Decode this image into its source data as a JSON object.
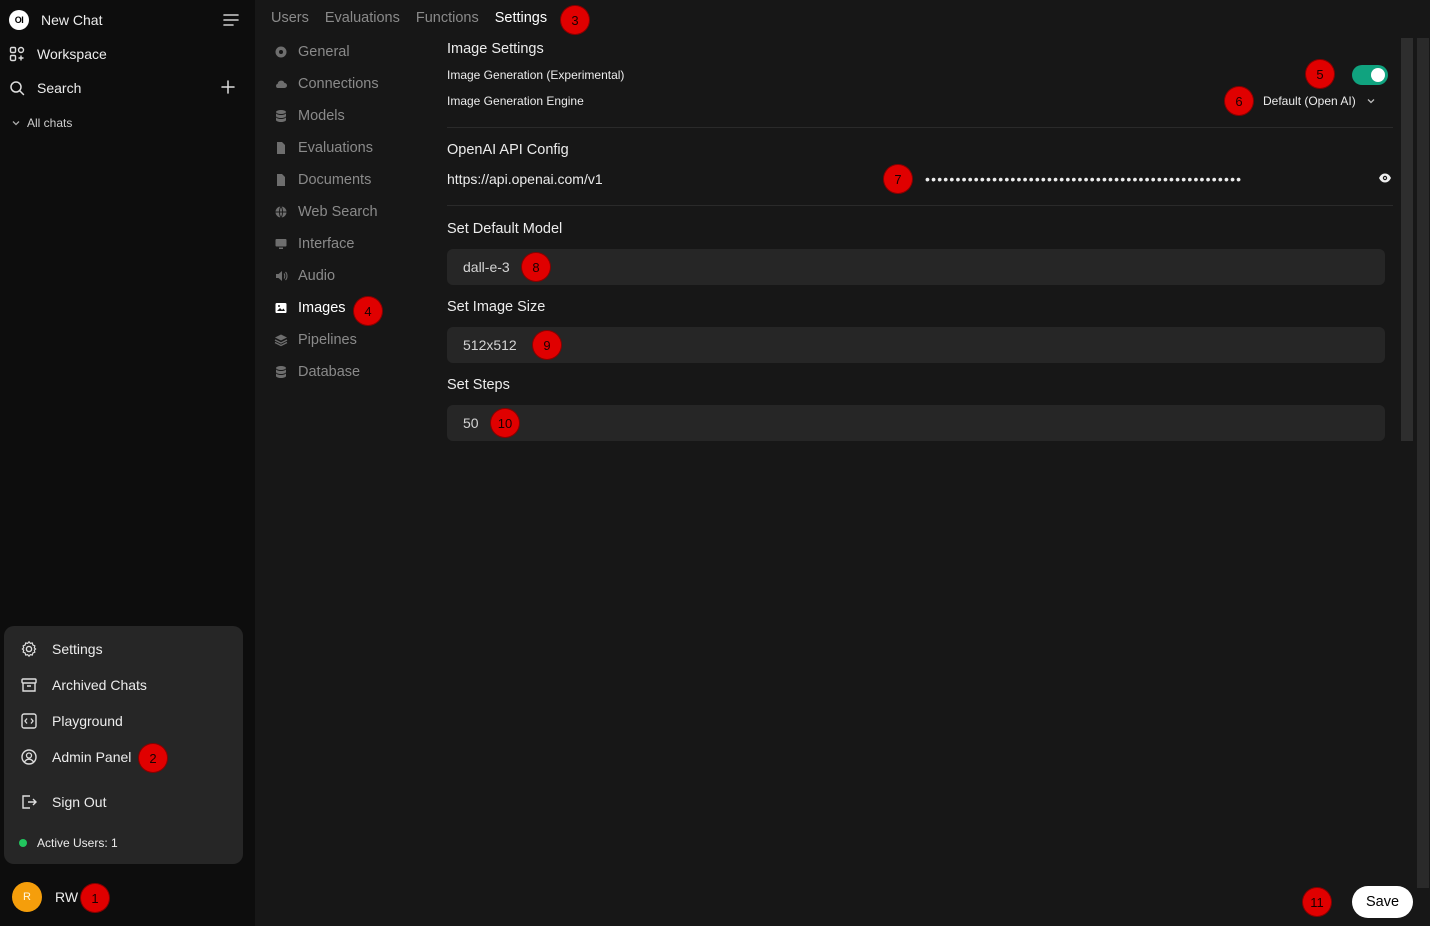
{
  "sidebar": {
    "new_chat": "New Chat",
    "logo_text": "OI",
    "workspace": "Workspace",
    "search": "Search",
    "all_chats": "All chats",
    "menu": {
      "settings": "Settings",
      "archived": "Archived Chats",
      "playground": "Playground",
      "admin": "Admin Panel",
      "signout": "Sign Out",
      "active_users": "Active Users: 1"
    },
    "user": {
      "initial": "R",
      "name": "RW"
    }
  },
  "top_tabs": [
    "Users",
    "Evaluations",
    "Functions",
    "Settings"
  ],
  "settings_nav": [
    "General",
    "Connections",
    "Models",
    "Evaluations",
    "Documents",
    "Web Search",
    "Interface",
    "Audio",
    "Images",
    "Pipelines",
    "Database"
  ],
  "images": {
    "title": "Image Settings",
    "gen_label": "Image Generation (Experimental)",
    "gen_enabled": true,
    "engine_label": "Image Generation Engine",
    "engine_value": "Default (Open AI)",
    "openai_title": "OpenAI API Config",
    "api_url": "https://api.openai.com/v1",
    "api_key_masked": "••••••••••••••••••••••••••••••••••••••••••••••••••••",
    "default_model_label": "Set Default Model",
    "default_model": "dall-e-3",
    "size_label": "Set Image Size",
    "size": "512x512",
    "steps_label": "Set Steps",
    "steps": "50"
  },
  "save_label": "Save",
  "badges": [
    "1",
    "2",
    "3",
    "4",
    "5",
    "6",
    "7",
    "8",
    "9",
    "10",
    "11"
  ],
  "colors": {
    "accent_toggle": "#10a37f",
    "badge": "#e00000",
    "avatar": "#f59e0b"
  }
}
